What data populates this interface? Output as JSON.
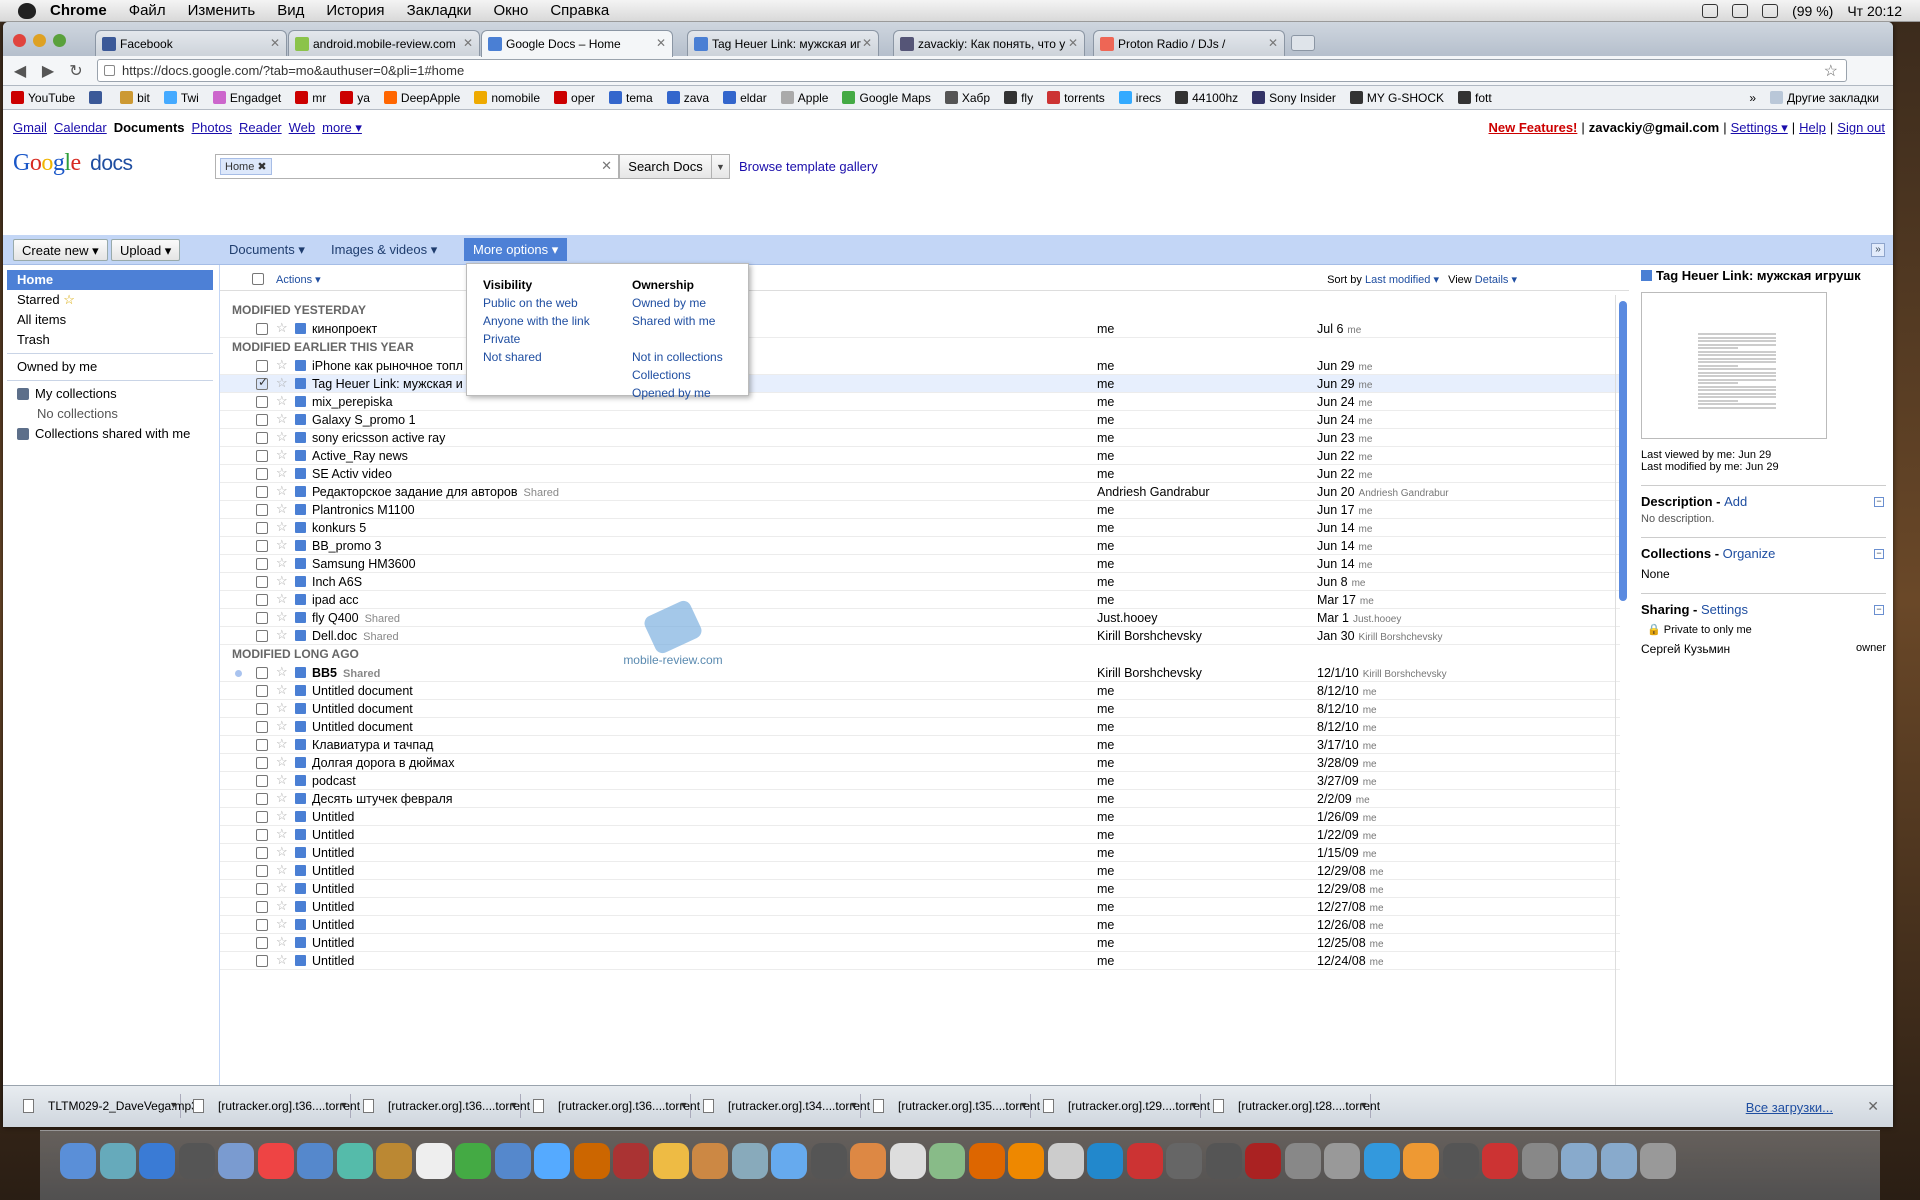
{
  "menubar": {
    "app": "Chrome",
    "items": [
      "Файл",
      "Изменить",
      "Вид",
      "История",
      "Закладки",
      "Окно",
      "Справка"
    ],
    "battery": "(99 %)",
    "clock": "Чт 20:12"
  },
  "tabs": [
    {
      "label": "Facebook",
      "color": "#3b5998"
    },
    {
      "label": "android.mobile-review.com",
      "color": "#8bc34a"
    },
    {
      "label": "Google Docs – Home",
      "color": "#4a7fd4"
    },
    {
      "label": "Tag Heuer Link: мужская иг",
      "color": "#4a7fd4"
    },
    {
      "label": "zavackiy: Как понять, что у",
      "color": "#557"
    },
    {
      "label": "Proton Radio / DJs /",
      "color": "#e65"
    }
  ],
  "address": "https://docs.google.com/?tab=mo&authuser=0&pli=1#home",
  "bookmarks": [
    "YouTube",
    "",
    "bit",
    "Twi",
    "Engadget",
    "mr",
    "ya",
    "DeepApple",
    "nomobile",
    "oper",
    "tema",
    "zava",
    "eldar",
    "Apple",
    "Google Maps",
    "Хабр",
    "fly",
    "torrents",
    "irecs",
    "44100hz",
    "Sony Insider",
    "MY G-SHOCK",
    "fott"
  ],
  "bookmarks_more": "»",
  "other_bookmarks": "Другие закладки",
  "gbar": {
    "items": [
      "Gmail",
      "Calendar",
      "Documents",
      "Photos",
      "Reader",
      "Web"
    ],
    "more": "more ▾"
  },
  "user": {
    "new": "New Features!",
    "email": "zavackiy@gmail.com",
    "settings": "Settings ▾",
    "help": "Help",
    "signout": "Sign out",
    "sep": "|"
  },
  "logo": {
    "google": "Google",
    "docs": "docs"
  },
  "search": {
    "chip": "Home ✖",
    "clear": "✕",
    "button": "Search Docs",
    "template": "Browse template gallery"
  },
  "actions": {
    "create": "Create new ▾",
    "upload": "Upload ▾",
    "documents": "Documents ▾",
    "images": "Images & videos ▾",
    "more": "More options ▾",
    "collapse": "»"
  },
  "sidebar": {
    "home": "Home",
    "starred": "Starred",
    "all": "All items",
    "trash": "Trash",
    "owned": "Owned by me",
    "mycoll": "My collections",
    "nocoll": "No collections",
    "shared": "Collections shared with me"
  },
  "listhead": {
    "actions": "Actions ▾",
    "sortby": "Sort by",
    "sortval": "Last modified ▾",
    "view": "View",
    "viewval": "Details ▾"
  },
  "dropdown": {
    "vis_title": "Visibility",
    "vis": [
      "Public on the web",
      "Anyone with the link",
      "Private",
      "Not shared"
    ],
    "own_title": "Ownership",
    "own": [
      "Owned by me",
      "Shared with me"
    ],
    "own2": [
      "Not in collections",
      "Collections",
      "Opened by me"
    ]
  },
  "groups": [
    "MODIFIED YESTERDAY",
    "MODIFIED EARLIER THIS YEAR",
    "MODIFIED LONG AGO"
  ],
  "shared_label": "Shared",
  "rows_yesterday": [
    {
      "name": "кинопроект",
      "owner": "me",
      "date": "Jul 6",
      "by": "me"
    }
  ],
  "rows_year": [
    {
      "name": "iPhone как рыночное топл",
      "owner": "me",
      "date": "Jun 29",
      "by": "me"
    },
    {
      "name": "Tag Heuer Link: мужская и",
      "owner": "me",
      "date": "Jun 29",
      "by": "me",
      "selected": true
    },
    {
      "name": "mix_perepiska",
      "owner": "me",
      "date": "Jun 24",
      "by": "me"
    },
    {
      "name": "Galaxy S_promo 1",
      "owner": "me",
      "date": "Jun 24",
      "by": "me"
    },
    {
      "name": "sony ericsson active ray",
      "owner": "me",
      "date": "Jun 23",
      "by": "me"
    },
    {
      "name": "Active_Ray news",
      "owner": "me",
      "date": "Jun 22",
      "by": "me"
    },
    {
      "name": "SE Activ video",
      "owner": "me",
      "date": "Jun 22",
      "by": "me"
    },
    {
      "name": "Редакторское задание для авторов",
      "shared": true,
      "owner": "Andriesh Gandrabur",
      "date": "Jun 20",
      "by": "Andriesh Gandrabur"
    },
    {
      "name": "Plantronics M1100",
      "owner": "me",
      "date": "Jun 17",
      "by": "me"
    },
    {
      "name": "konkurs 5",
      "owner": "me",
      "date": "Jun 14",
      "by": "me"
    },
    {
      "name": "BB_promo 3",
      "owner": "me",
      "date": "Jun 14",
      "by": "me"
    },
    {
      "name": "Samsung HM3600",
      "owner": "me",
      "date": "Jun 14",
      "by": "me"
    },
    {
      "name": "Inch A6S",
      "owner": "me",
      "date": "Jun 8",
      "by": "me"
    },
    {
      "name": "ipad acc",
      "owner": "me",
      "date": "Mar 17",
      "by": "me"
    },
    {
      "name": "fly Q400",
      "shared": true,
      "owner": "Just.hooey",
      "date": "Mar 1",
      "by": "Just.hooey"
    },
    {
      "name": "Dell.doc",
      "shared": true,
      "owner": "Kirill Borshchevsky",
      "date": "Jan 30",
      "by": "Kirill Borshchevsky"
    }
  ],
  "rows_old": [
    {
      "name": "BB5",
      "shared": true,
      "bold": true,
      "unread": true,
      "owner": "Kirill Borshchevsky",
      "date": "12/1/10",
      "by": "Kirill Borshchevsky"
    },
    {
      "name": "Untitled document",
      "owner": "me",
      "date": "8/12/10",
      "by": "me"
    },
    {
      "name": "Untitled document",
      "owner": "me",
      "date": "8/12/10",
      "by": "me"
    },
    {
      "name": "Untitled document",
      "owner": "me",
      "date": "8/12/10",
      "by": "me"
    },
    {
      "name": "Клавиатура и тачпад",
      "owner": "me",
      "date": "3/17/10",
      "by": "me"
    },
    {
      "name": "Долгая дорога в дюймах",
      "owner": "me",
      "date": "3/28/09",
      "by": "me"
    },
    {
      "name": "podcast",
      "owner": "me",
      "date": "3/27/09",
      "by": "me"
    },
    {
      "name": "Десять штучек февраля",
      "owner": "me",
      "date": "2/2/09",
      "by": "me"
    },
    {
      "name": "Untitled",
      "owner": "me",
      "date": "1/26/09",
      "by": "me"
    },
    {
      "name": "Untitled",
      "owner": "me",
      "date": "1/22/09",
      "by": "me"
    },
    {
      "name": "Untitled",
      "owner": "me",
      "date": "1/15/09",
      "by": "me"
    },
    {
      "name": "Untitled",
      "owner": "me",
      "date": "12/29/08",
      "by": "me"
    },
    {
      "name": "Untitled",
      "owner": "me",
      "date": "12/29/08",
      "by": "me"
    },
    {
      "name": "Untitled",
      "owner": "me",
      "date": "12/27/08",
      "by": "me"
    },
    {
      "name": "Untitled",
      "owner": "me",
      "date": "12/26/08",
      "by": "me"
    },
    {
      "name": "Untitled",
      "owner": "me",
      "date": "12/25/08",
      "by": "me"
    },
    {
      "name": "Untitled",
      "owner": "me",
      "date": "12/24/08",
      "by": "me"
    }
  ],
  "watermark": "mobile-review.com",
  "preview": {
    "title": "Tag Heuer Link: мужская игрушк",
    "viewed": "Last viewed by me: Jun 29",
    "modified": "Last modified by me: Jun 29",
    "desc_h": "Description",
    "desc_link": "Add",
    "desc": "No description.",
    "coll_h": "Collections",
    "coll_link": "Organize",
    "coll": "None",
    "share_h": "Sharing",
    "share_link": "Settings",
    "private": "Private to only me",
    "person": "Сергей Кузьмин",
    "role": "owner",
    "dash": " - "
  },
  "downloads": [
    "TLTM029-2_DaveVega.mp3",
    "[rutracker.org].t36....torrent",
    "[rutracker.org].t36....torrent",
    "[rutracker.org].t36....torrent",
    "[rutracker.org].t34....torrent",
    "[rutracker.org].t35....torrent",
    "[rutracker.org].t29....torrent",
    "[rutracker.org].t28....torrent"
  ],
  "downloads_all": "Все загрузки...",
  "colors": {
    "accent": "#4d80d6",
    "actionbar": "#c3d6f6",
    "link": "#1f4ea1"
  }
}
